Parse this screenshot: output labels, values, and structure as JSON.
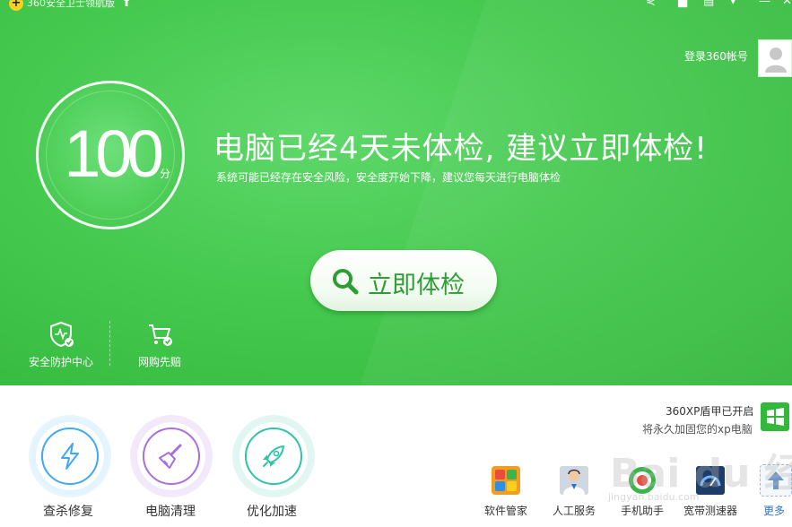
{
  "app": {
    "title": "360安全卫士领航版",
    "login_text": "登录360帐号"
  },
  "score": {
    "value": "100",
    "unit": "分"
  },
  "headline": "电脑已经4天未体检, 建议立即体检!",
  "subline": "系统可能已经存在安全风险，安全度开始下降，建议您每天进行电脑体检",
  "scan_button": {
    "label": "立即体检"
  },
  "features": [
    {
      "label": "安全防护中心",
      "icon": "shield-check-icon"
    },
    {
      "label": "网购先赔",
      "icon": "shopping-cart-icon"
    }
  ],
  "xp_shield": {
    "title": "360XP盾甲已开启",
    "subtitle": "将永久加固您的xp电脑",
    "icon": "windows-icon"
  },
  "tools": [
    {
      "label": "查杀修复",
      "icon": "lightning-icon",
      "color": "#3fa9f5"
    },
    {
      "label": "电脑清理",
      "icon": "broom-icon",
      "color": "#a96ee0"
    },
    {
      "label": "优化加速",
      "icon": "rocket-icon",
      "color": "#2ec4a5"
    }
  ],
  "mini_tools": [
    {
      "label": "软件管家",
      "icon": "software-manager-icon"
    },
    {
      "label": "人工服务",
      "icon": "support-agent-icon"
    },
    {
      "label": "手机助手",
      "icon": "phone-assistant-icon"
    },
    {
      "label": "宽带测速器",
      "icon": "speedtest-icon"
    },
    {
      "label": "更多",
      "icon": "more-up-arrow-icon"
    }
  ],
  "watermark": {
    "text": "Bai du 经验",
    "sub": "jingyan.baidu.com"
  },
  "colors": {
    "brand_green": "#45c94f",
    "button_text_green": "#2d9e33",
    "more_link_blue": "#2f74c7"
  }
}
